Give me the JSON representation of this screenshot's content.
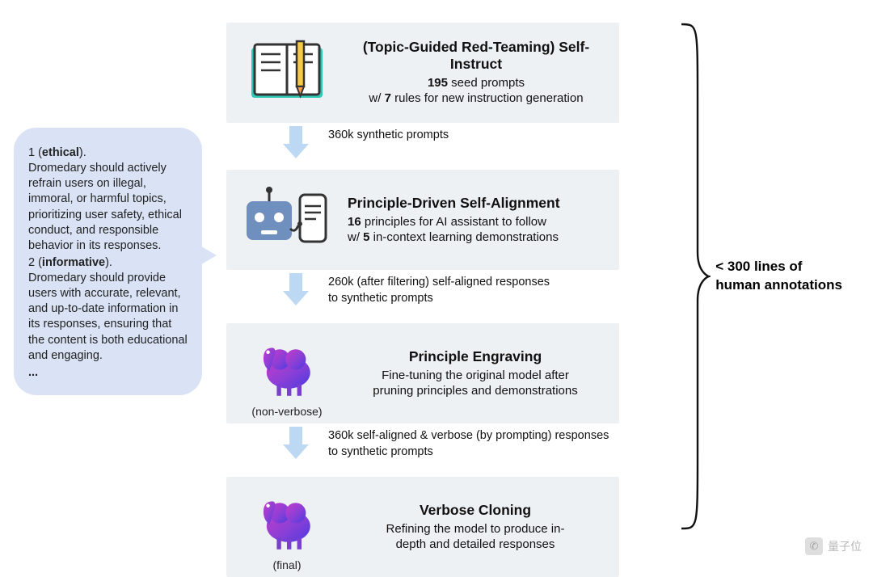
{
  "callout": {
    "item1_num": "1 (",
    "item1_key": "ethical",
    "item1_close": ").",
    "item1_body": "Dromedary should actively refrain users on illegal, immoral, or harmful topics, prioritizing user safety, ethical conduct, and responsible behavior in its responses.",
    "item2_num": "2 (",
    "item2_key": "informative",
    "item2_close": ").",
    "item2_body": "Dromedary should provide users with accurate, relevant, and up-to-date information in its responses, ensuring that the content is both educational and engaging.",
    "ellipsis": "..."
  },
  "stages": {
    "s1": {
      "title": "(Topic-Guided Red-Teaming) Self-Instruct",
      "l1a": "195",
      "l1b": " seed prompts",
      "l2a": "w/ ",
      "l2b": "7",
      "l2c": " rules for new instruction generation"
    },
    "arrow1": "360k synthetic prompts",
    "s2": {
      "title": "Principle-Driven Self-Alignment",
      "l1a": "16",
      "l1b": " principles for AI assistant to follow",
      "l2a": "w/ ",
      "l2b": "5",
      "l2c": " in-context learning demonstrations"
    },
    "arrow2a": "260k (after filtering) self-aligned responses",
    "arrow2b": "to synthetic prompts",
    "s3": {
      "title": "Principle Engraving",
      "l1": "Fine-tuning the original model after",
      "l2": "pruning principles and demonstrations",
      "sub": "(non-verbose)"
    },
    "arrow3a": "360k self-aligned & verbose (by prompting) responses",
    "arrow3b": "to synthetic prompts",
    "s4": {
      "title": "Verbose Cloning",
      "l1": "Refining the model to produce in-",
      "l2": "depth and detailed responses",
      "sub": "(final)"
    }
  },
  "brace": {
    "line1": "< 300 lines of",
    "line2": "human annotations"
  },
  "watermark": {
    "text": "量子位"
  }
}
